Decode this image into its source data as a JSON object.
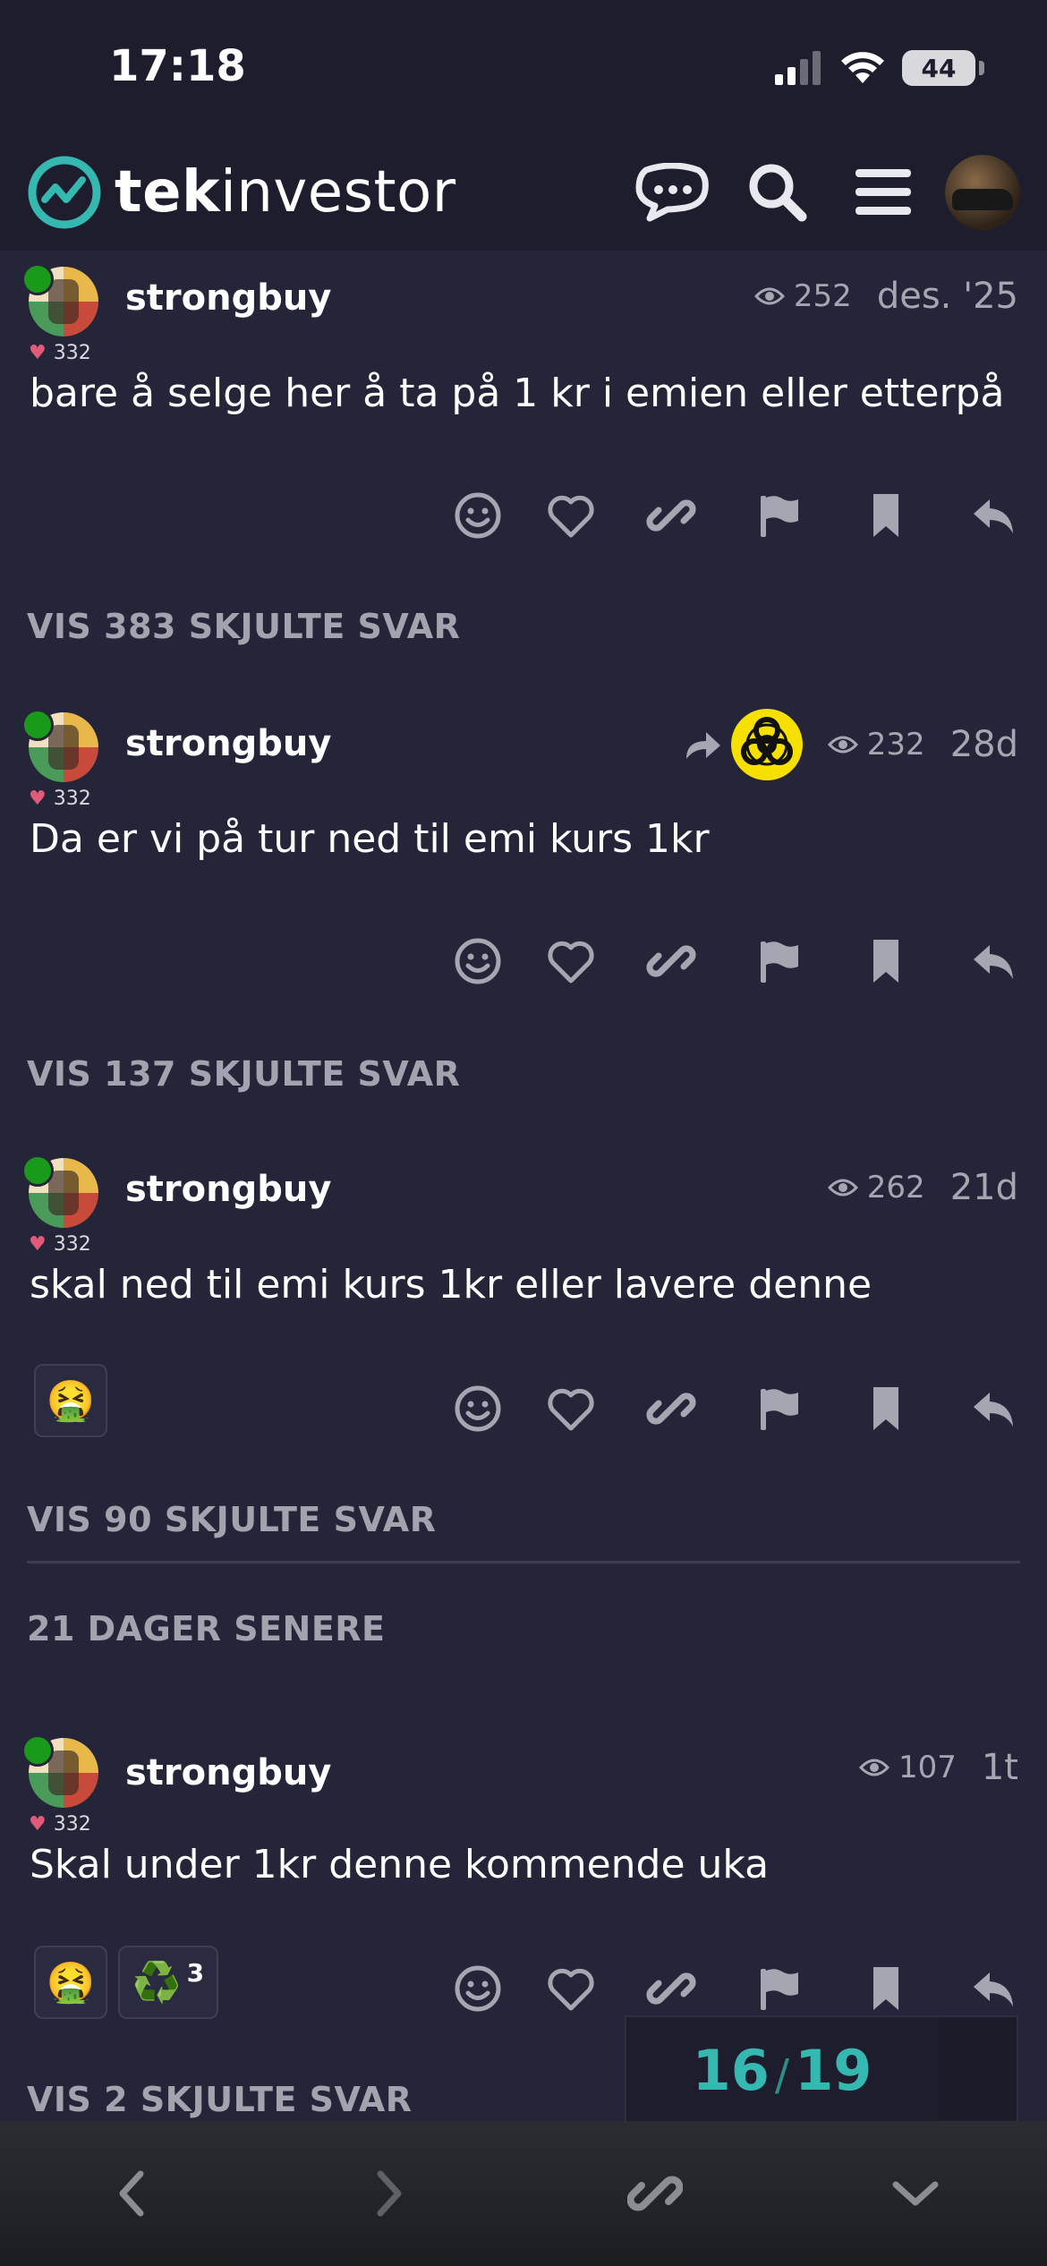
{
  "status_bar": {
    "time": "17:18",
    "battery": "44"
  },
  "header": {
    "logo_bold": "tek",
    "logo_regular": "investor",
    "icons": [
      "chat-icon",
      "search-icon",
      "hamburger-menu-icon",
      "user-avatar"
    ]
  },
  "posts": [
    {
      "username": "strongbuy",
      "likes": "332",
      "views": "252",
      "date": "des. '25",
      "text": "bare å selge her å ta på 1 kr i emien eller etterpå",
      "hidden_replies": "VIS 383 SKJULTE SVAR"
    },
    {
      "username": "strongbuy",
      "likes": "332",
      "views": "232",
      "date": "28d",
      "text": "Da er vi på tur ned til emi kurs 1kr",
      "hidden_replies": "VIS 137 SKJULTE SVAR"
    },
    {
      "username": "strongbuy",
      "likes": "332",
      "views": "262",
      "date": "21d",
      "text": "skal ned til emi kurs 1kr eller lavere denne",
      "reactions": [
        {
          "emoji": "🤮",
          "count": ""
        }
      ],
      "hidden_replies": "VIS 90 SKJULTE SVAR"
    },
    {
      "username": "strongbuy",
      "likes": "332",
      "views": "107",
      "date": "1t",
      "text": "Skal under 1kr denne kommende uka",
      "reactions": [
        {
          "emoji": "🤮",
          "count": ""
        },
        {
          "emoji": "♻️",
          "count": "3"
        }
      ],
      "hidden_replies": "VIS 2 SKJULTE SVAR"
    }
  ],
  "time_gap": "21 DAGER SENERE",
  "progress": {
    "current": "16",
    "total": "19",
    "separator": "/"
  },
  "colors": {
    "background": "#25253a",
    "header": "#1d1d2d",
    "accent": "#35b8b0",
    "muted": "#a3a3b0"
  }
}
